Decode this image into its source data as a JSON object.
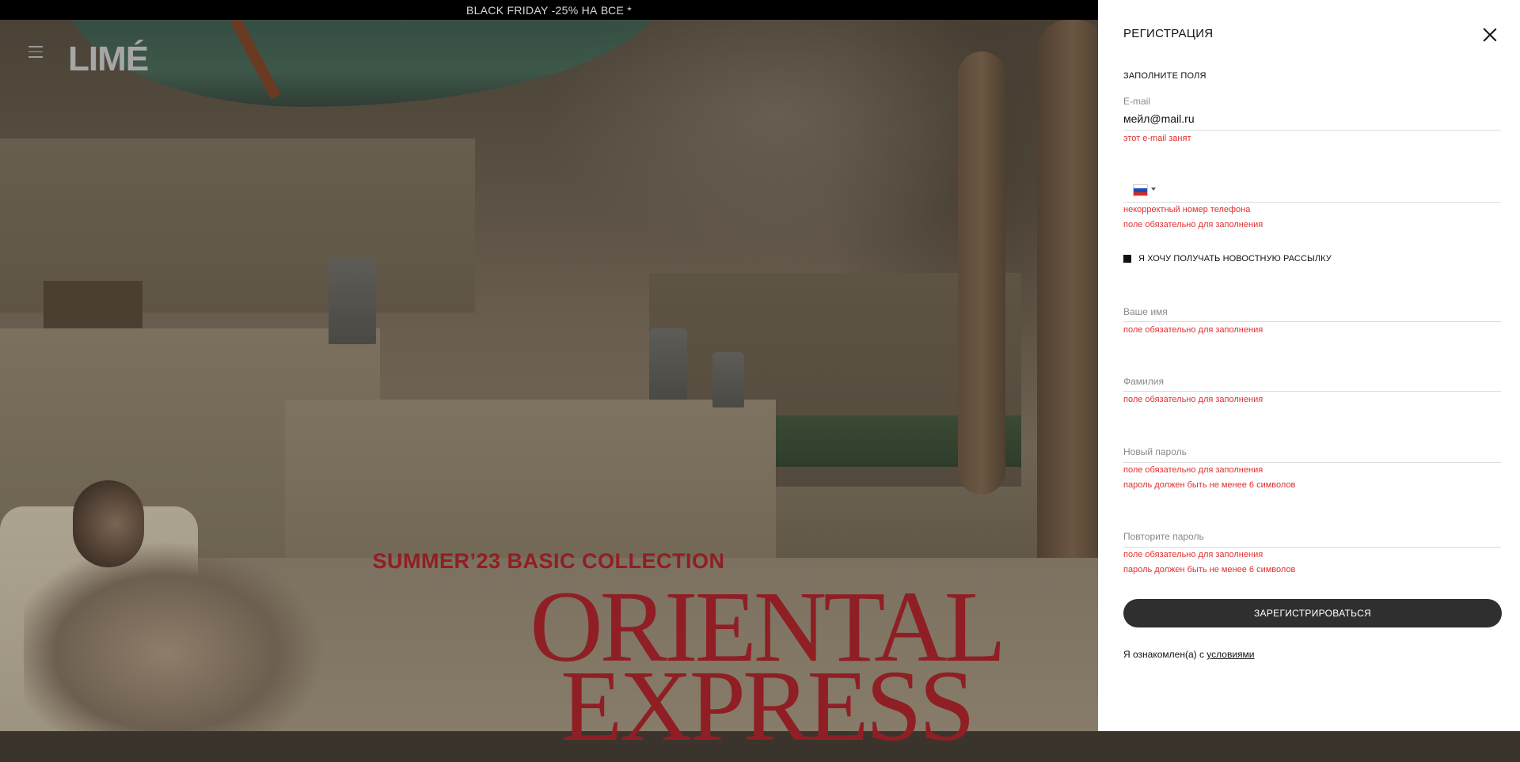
{
  "banner": {
    "text": "BLACK FRIDAY -25% НА ВСЕ *"
  },
  "header": {
    "logo": "LIMÉ",
    "menu_icon": "hamburger-menu-icon"
  },
  "hero": {
    "collection": "SUMMER’23 BASIC COLLECTION",
    "title_line1": "ORIENTAL",
    "title_line2": "EXPRESS"
  },
  "panel": {
    "title": "РЕГИСТРАЦИЯ",
    "close_icon": "close-icon",
    "section_label": "ЗАПОЛНИТЕ ПОЛЯ",
    "email": {
      "label": "E-mail",
      "value": "мейл@mail.ru",
      "errors": [
        "этот e-mail занят"
      ]
    },
    "phone": {
      "country_flag": "russia-flag-icon",
      "flag_colors": [
        "#ffffff",
        "#1c4bb8",
        "#d52b1e"
      ],
      "value": "",
      "errors": [
        "некорректный номер телефона",
        "поле обязательно для заполнения"
      ]
    },
    "newsletter": {
      "label": "Я ХОЧУ ПОЛУЧАТЬ НОВОСТНУЮ РАССЫЛКУ",
      "checked": true
    },
    "first_name": {
      "placeholder": "Ваше имя",
      "errors": [
        "поле обязательно для заполнения"
      ]
    },
    "last_name": {
      "placeholder": "Фамилия",
      "errors": [
        "поле обязательно для заполнения"
      ]
    },
    "new_password": {
      "placeholder": "Новый пароль",
      "errors": [
        "поле обязательно для заполнения",
        "пароль должен быть не менее 6 символов"
      ]
    },
    "repeat_password": {
      "placeholder": "Повторите пароль",
      "errors": [
        "поле обязательно для заполнения",
        "пароль должен быть не менее 6 символов"
      ]
    },
    "submit_label": "ЗАРЕГИСТРИРОВАТЬСЯ",
    "terms_prefix": "Я ознакомлен(а) с",
    "terms_link": "условиями"
  },
  "colors": {
    "accent_red": "#8f1f24",
    "error_red": "#e0302f",
    "button_dark": "#2f2f2f"
  }
}
